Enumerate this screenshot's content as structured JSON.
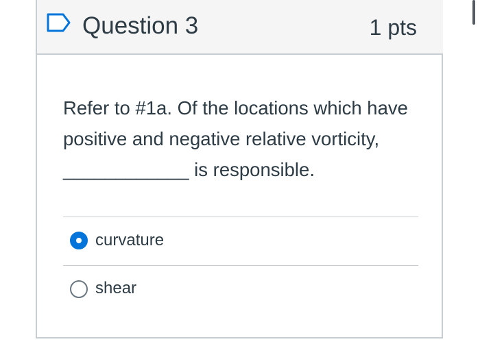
{
  "question": {
    "title": "Question 3",
    "points": "1 pts",
    "text": "Refer to #1a. Of the locations which have positive and negative relative vorticity, ____________ is responsible."
  },
  "icons": {
    "flag": "flag-icon"
  },
  "answers": [
    {
      "label": "curvature",
      "selected": true
    },
    {
      "label": "shear",
      "selected": false
    }
  ],
  "colors": {
    "accent": "#0374d9",
    "text": "#2d3b45",
    "header_background": "#f5f5f5",
    "border": "#c7cdd1"
  }
}
